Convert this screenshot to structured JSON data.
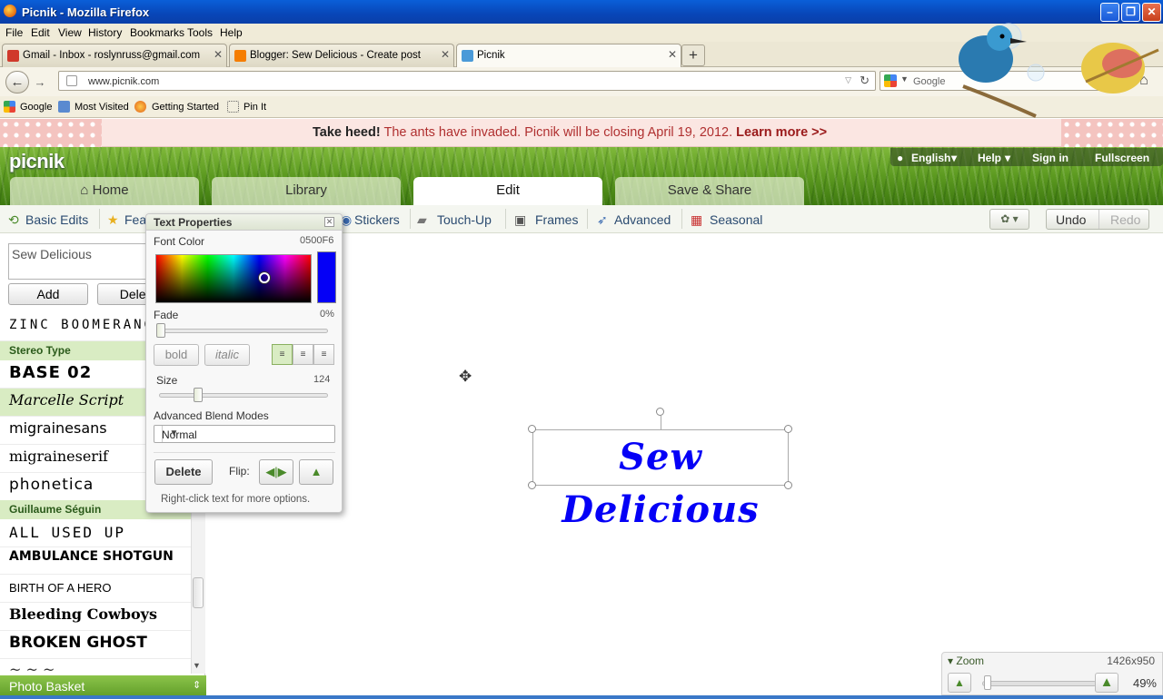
{
  "browser": {
    "title": "Picnik - Mozilla Firefox",
    "menu": [
      "File",
      "Edit",
      "View",
      "History",
      "Bookmarks",
      "Tools",
      "Help"
    ],
    "tabs": [
      {
        "label": "Gmail - Inbox - roslynruss@gmail.com",
        "icon": "gmail-icon",
        "color": "#d0392b"
      },
      {
        "label": "Blogger: Sew Delicious - Create post",
        "icon": "blogger-icon",
        "color": "#f57d00"
      },
      {
        "label": "Picnik",
        "icon": "picnik-icon",
        "color": "#4a9ad8",
        "active": true
      }
    ],
    "url": "www.picnik.com",
    "search_placeholder": "Google",
    "bookmarks": [
      "Google",
      "Most Visited",
      "Getting Started",
      "Pin It"
    ]
  },
  "notice": {
    "bold": "Take heed!",
    "message": "The ants have invaded. Picnik will be closing April 19, 2012.",
    "link": "Learn more >>"
  },
  "app": {
    "logo": "picnik",
    "top_links": [
      "English",
      "Help",
      "Sign in",
      "Fullscreen"
    ],
    "main_tabs": [
      "Home",
      "Library",
      "Edit",
      "Save & Share"
    ],
    "active_tab": "Edit",
    "toolbar": [
      "Basic Edits",
      "Featured",
      "Stickers",
      "Touch-Up",
      "Frames",
      "Advanced",
      "Seasonal"
    ],
    "undo": "Undo",
    "redo": "Redo"
  },
  "left_panel": {
    "text_value": "Sew Delicious",
    "add_label": "Add",
    "delete_label": "Delete",
    "groups": [
      {
        "name": "Stereo Type",
        "fonts": [
          "BASE 02",
          "Marcelle Script",
          "migrainesans",
          "migraineserif",
          "phonetica"
        ]
      },
      {
        "name": "Guillaume Séguin",
        "fonts": [
          "ALL USED UP",
          "AMBULANCE SHOTGUN",
          "BIRTH OF A HERO",
          "Bleeding Cowboys",
          "BROKEN GHOST"
        ]
      }
    ],
    "top_font": "ZINC BOOMERANG",
    "photo_basket": "Photo Basket"
  },
  "text_properties": {
    "title": "Text Properties",
    "font_color_label": "Font Color",
    "font_color_value": "0500F6",
    "font_color": "#0500f6",
    "fade_label": "Fade",
    "fade_value": "0%",
    "fade": 0,
    "bold": "bold",
    "italic": "italic",
    "size_label": "Size",
    "size_value": "124",
    "blend_label": "Advanced Blend Modes",
    "blend_value": "Normal",
    "delete": "Delete",
    "flip_label": "Flip:",
    "hint": "Right-click text for more options."
  },
  "canvas": {
    "text": "Sew Delicious",
    "text_color": "#0500f6"
  },
  "zoom": {
    "label": "Zoom",
    "dimensions": "1426x950",
    "percent": "49%"
  }
}
